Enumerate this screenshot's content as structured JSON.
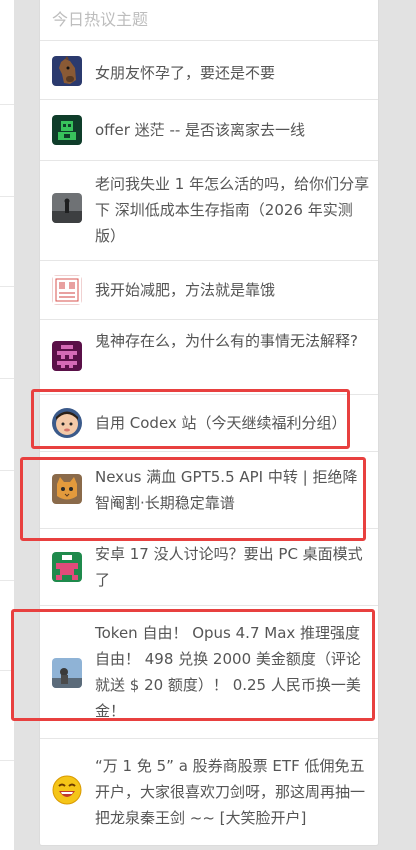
{
  "panel": {
    "title": "今日热议主题",
    "topics": [
      {
        "title": "女朋友怀孕了，要还是不要",
        "avatar_icon": "horse-mask-avatar-icon"
      },
      {
        "title": "offer 迷茫 -- 是否该离家去一线",
        "avatar_icon": "green-robot-avatar-icon"
      },
      {
        "title": "老问我失业 1 年怎么活的吗，给你们分享下 深圳低成本生存指南（2026 年实测版）",
        "avatar_icon": "dark-photo-avatar-icon"
      },
      {
        "title": "我开始减肥，方法就是靠饿",
        "avatar_icon": "stamp-seal-avatar-icon"
      },
      {
        "title": "鬼神存在么，为什么有的事情无法解释?",
        "avatar_icon": "purple-pixel-avatar-icon"
      },
      {
        "title": "自用 Codex 站（今天继续福利分组）",
        "avatar_icon": "child-face-avatar-icon"
      },
      {
        "title": "Nexus 满血 GPT5.5 API 中转 | 拒绝降智阉割·长期稳定靠谱",
        "avatar_icon": "cat-face-avatar-icon"
      },
      {
        "title": "安卓 17 没人讨论吗？要出 PC 桌面模式了",
        "avatar_icon": "green-pixel-avatar-icon"
      },
      {
        "title": "Token 自由！ Opus 4.7 Max 推理强度自由！ 498 兑换 2000 美金额度（评论就送 $ 20 额度）！ 0.25 人民币换一美金！",
        "avatar_icon": "landscape-photo-avatar-icon"
      },
      {
        "title": "“万 1 免 5” a 股券商股票 ETF 低佣免五开户，大家很喜欢刀剑呀，那这周再抽一把龙泉秦王剑 ~~ [大笑脸开户]",
        "avatar_icon": "laughing-emoji-avatar-icon"
      }
    ]
  }
}
